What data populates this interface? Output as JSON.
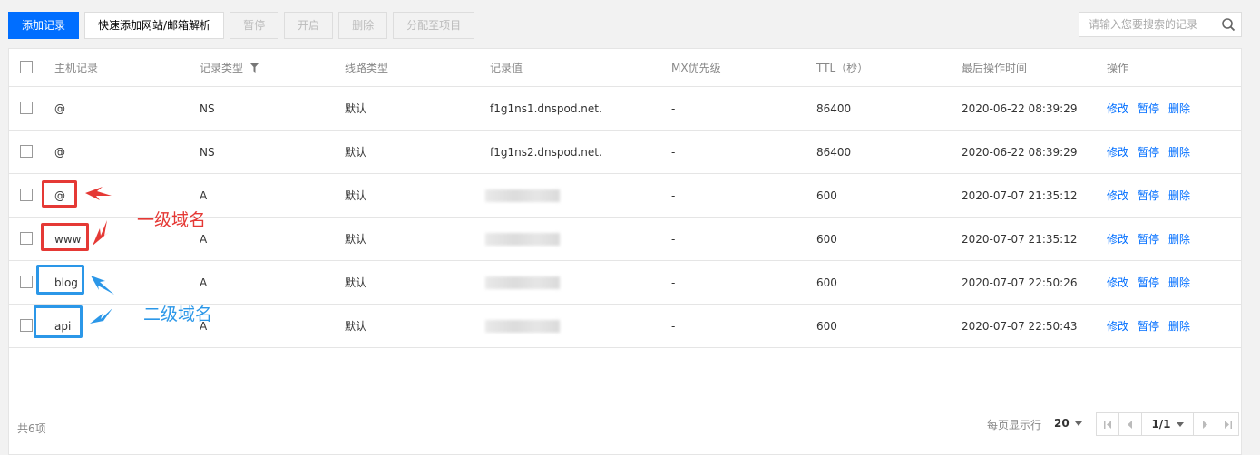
{
  "toolbar": {
    "add_record": "添加记录",
    "quick_add": "快速添加网站/邮箱解析",
    "pause": "暂停",
    "enable": "开启",
    "delete": "删除",
    "assign_project": "分配至项目"
  },
  "search": {
    "placeholder": "请输入您要搜索的记录"
  },
  "table": {
    "headers": {
      "host": "主机记录",
      "type": "记录类型",
      "line": "线路类型",
      "value": "记录值",
      "mx": "MX优先级",
      "ttl": "TTL（秒）",
      "updated": "最后操作时间",
      "actions": "操作"
    },
    "rows": [
      {
        "host": "@",
        "type": "NS",
        "line": "默认",
        "value": "f1g1ns1.dnspod.net.",
        "mx": "-",
        "ttl": "86400",
        "updated": "2020-06-22 08:39:29"
      },
      {
        "host": "@",
        "type": "NS",
        "line": "默认",
        "value": "f1g1ns2.dnspod.net.",
        "mx": "-",
        "ttl": "86400",
        "updated": "2020-06-22 08:39:29"
      },
      {
        "host": "@",
        "type": "A",
        "line": "默认",
        "value": "",
        "mx": "-",
        "ttl": "600",
        "updated": "2020-07-07 21:35:12"
      },
      {
        "host": "www",
        "type": "A",
        "line": "默认",
        "value": "",
        "mx": "-",
        "ttl": "600",
        "updated": "2020-07-07 21:35:12"
      },
      {
        "host": "blog",
        "type": "A",
        "line": "默认",
        "value": "",
        "mx": "-",
        "ttl": "600",
        "updated": "2020-07-07 22:50:26"
      },
      {
        "host": "api",
        "type": "A",
        "line": "默认",
        "value": "",
        "mx": "-",
        "ttl": "600",
        "updated": "2020-07-07 22:50:43"
      }
    ],
    "action_labels": {
      "edit": "修改",
      "pause": "暂停",
      "delete": "删除"
    }
  },
  "annotations": {
    "first_level": "一级域名",
    "second_level": "二级域名",
    "first_color": "#e53935",
    "second_color": "#2b97e8"
  },
  "footer": {
    "total": "共6项",
    "per_page_label": "每页显示行",
    "per_page": "20",
    "page": "1/1"
  },
  "colors": {
    "primary": "#006eff",
    "link": "#006eff"
  }
}
